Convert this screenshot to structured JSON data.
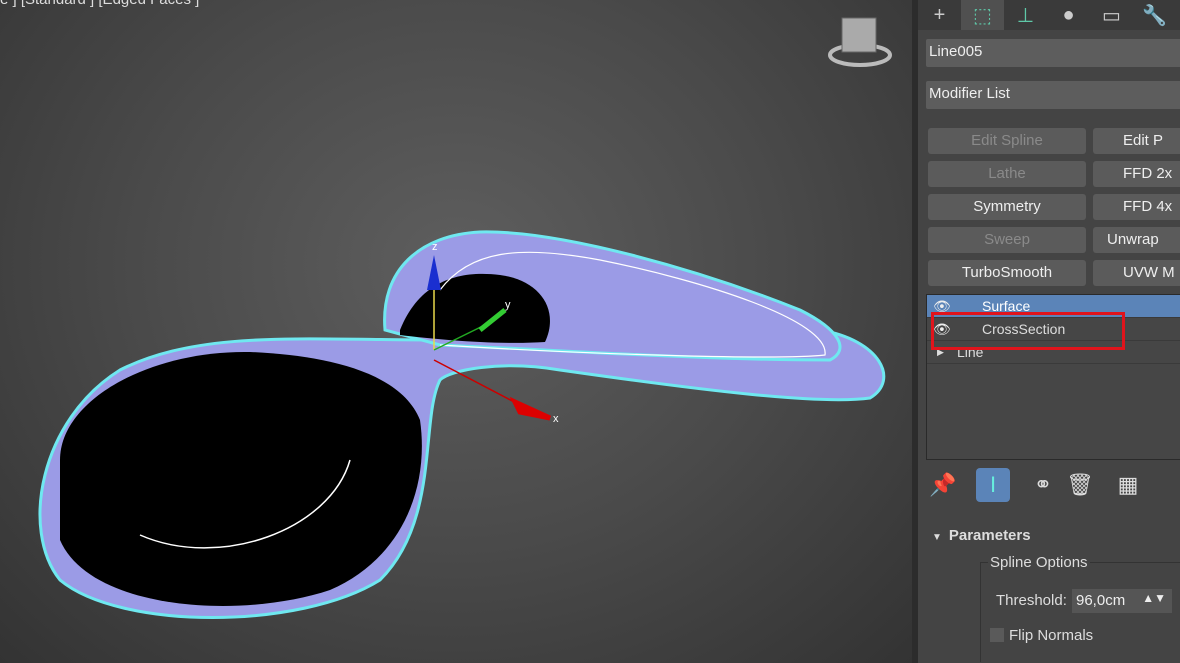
{
  "viewport": {
    "label": "e ] [Standard ] [Edged Faces ]",
    "axis_x": "x",
    "axis_y": "y",
    "axis_z": "z"
  },
  "command_panel": {
    "tabs": [
      "create",
      "modify",
      "hierarchy",
      "motion",
      "display",
      "utilities"
    ],
    "object_name": "Line005",
    "modifier_list": "Modifier List",
    "buttons": [
      {
        "label": "Edit Spline",
        "enabled": false
      },
      {
        "label": "Edit P",
        "enabled": true
      },
      {
        "label": "Lathe",
        "enabled": false
      },
      {
        "label": "FFD 2x",
        "enabled": true
      },
      {
        "label": "Symmetry",
        "enabled": true
      },
      {
        "label": "FFD 4x",
        "enabled": true
      },
      {
        "label": "Sweep",
        "enabled": false
      },
      {
        "label": "Unwrap",
        "enabled": true
      },
      {
        "label": "TurboSmooth",
        "enabled": true
      },
      {
        "label": "UVW M",
        "enabled": true
      }
    ],
    "stack": [
      {
        "label": "Surface",
        "selected": true
      },
      {
        "label": "CrossSection",
        "selected": false
      },
      {
        "label": "Line",
        "selected": false
      }
    ],
    "parameters": {
      "title": "Parameters",
      "group": "Spline Options",
      "threshold_label": "Threshold:",
      "threshold_value": "96,0cm",
      "flip_normals": "Flip Normals"
    }
  }
}
